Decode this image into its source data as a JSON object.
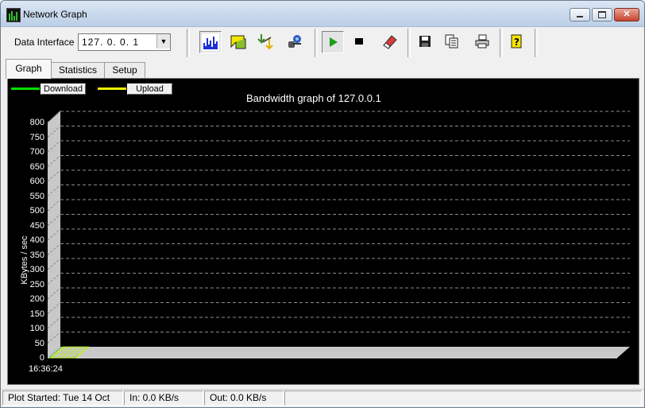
{
  "window": {
    "title": "Network Graph"
  },
  "toolbar": {
    "interface_label": "Data Interface",
    "interface_value": "127. 0. 0. 1",
    "buttons": [
      "bar-graph-icon",
      "highlighter-icon",
      "refresh-arrows-icon",
      "find-person-icon",
      "play-icon",
      "stop-icon",
      "eraser-icon",
      "save-icon",
      "copy-icon",
      "print-icon",
      "help-icon"
    ]
  },
  "tabs": {
    "graph": "Graph",
    "statistics": "Statistics",
    "setup": "Setup"
  },
  "chart_data": {
    "type": "area",
    "title": "Bandwidth graph of 127.0.0.1",
    "ylabel": "KBytes / sec",
    "ylim": [
      0,
      800
    ],
    "yticks": [
      "800",
      "750",
      "700",
      "650",
      "600",
      "550",
      "500",
      "450",
      "400",
      "350",
      "300",
      "250",
      "200",
      "150",
      "100",
      "50",
      "0"
    ],
    "categories": [
      "16:36:24"
    ],
    "series": [
      {
        "name": "Download",
        "values": [
          0
        ],
        "color": "#00e000"
      },
      {
        "name": "Upload",
        "values": [
          0
        ],
        "color": "#f0f000"
      }
    ],
    "grid": true,
    "legend": "top-left"
  },
  "status": {
    "started": "Plot Started: Tue 14 Oct",
    "in": "In: 0.0 KB/s",
    "out": "Out: 0.0 KB/s"
  },
  "colors": {
    "graph_bg": "#000000",
    "download": "#00e000",
    "upload": "#f0f000",
    "play": "#18a018"
  }
}
